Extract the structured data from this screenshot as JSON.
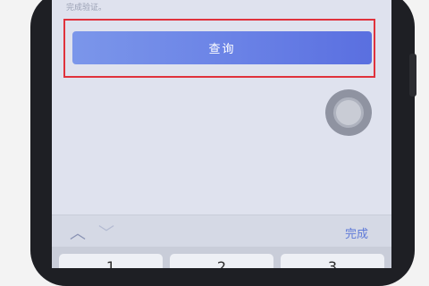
{
  "screen": {
    "hint_text": "完成验证。",
    "query_button_label": "查询"
  },
  "toolbar": {
    "prev_icon": "chevron-up-icon",
    "next_icon": "chevron-down-icon",
    "done_label": "完成"
  },
  "keypad": {
    "keys": [
      "1",
      "2",
      "3"
    ]
  },
  "colors": {
    "button_gradient_start": "#7b96ea",
    "button_gradient_end": "#5a6fe0",
    "highlight_border": "#e0323c",
    "done_link": "#5f7ad8"
  }
}
